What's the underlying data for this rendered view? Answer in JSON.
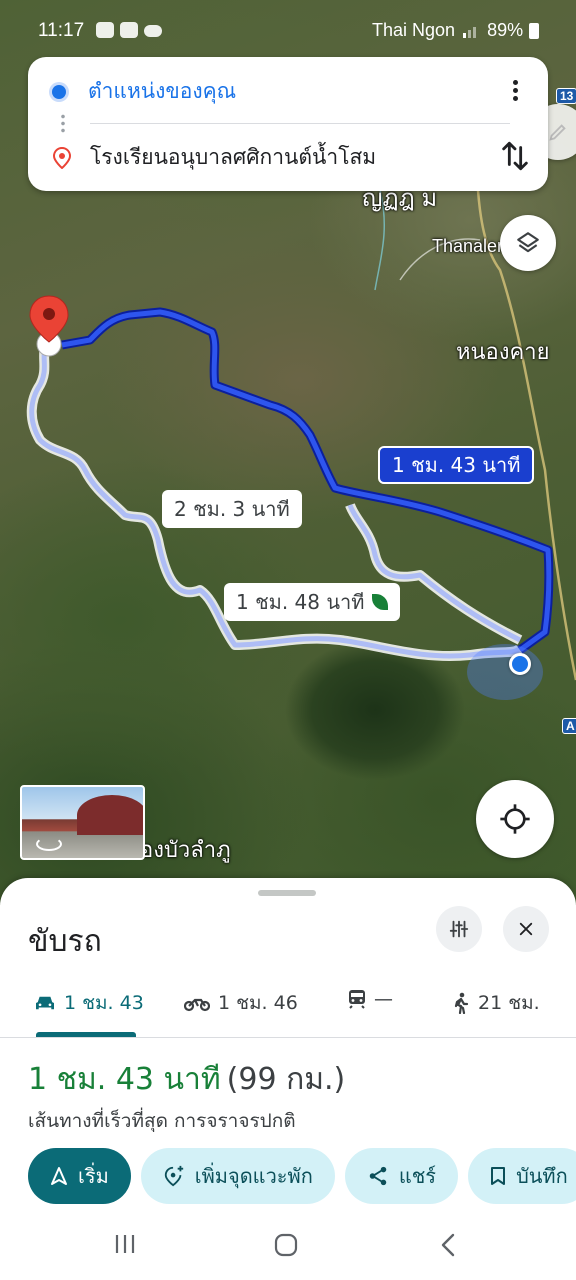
{
  "status_bar": {
    "time": "11:17",
    "carrier": "Thai Ngon",
    "battery": "89%",
    "icons": [
      "line-icon",
      "image-icon",
      "cloud-icon",
      "wifi-icon",
      "signal-icon",
      "battery-icon"
    ]
  },
  "route_inputs": {
    "origin": "ตำแหน่งของคุณ",
    "destination": "โรงเรียนอนุบาลศศิกานต์น้ำโสม"
  },
  "map": {
    "labels": {
      "thanaleng": "Thanalen",
      "nong_khai": "หนองคาย",
      "nong_bua_lam_phu": "องบัวลำภู",
      "partial_top": "ญฏฎ ม"
    },
    "shields": {
      "highway_13": "13",
      "highway_a": "A"
    },
    "callouts": {
      "main": "1 ชม. 43 นาที",
      "alt1": "2 ชม. 3 นาที",
      "alt2": "1 ชม. 48 นาที"
    },
    "colors": {
      "main_route": "#1a3fcf",
      "alt_route": "#aebdf5",
      "origin": "#1a73e8",
      "pin": "#ea4335"
    }
  },
  "sheet": {
    "title": "ขับรถ",
    "modes": [
      {
        "id": "car",
        "label": "1 ชม. 43",
        "icon": "car-icon",
        "active": true
      },
      {
        "id": "moto",
        "label": "1 ชม. 46",
        "icon": "motorcycle-icon",
        "active": false
      },
      {
        "id": "transit",
        "label": "—",
        "icon": "transit-icon",
        "active": false
      },
      {
        "id": "walk",
        "label": "21 ชม.",
        "icon": "walk-icon",
        "active": false
      }
    ],
    "duration": "1 ชม. 43 นาที",
    "distance": "(99 กม.)",
    "subline": "เส้นทางที่เร็วที่สุด การจราจรปกติ",
    "actions": {
      "start": "เริ่ม",
      "add_stop": "เพิ่มจุดแวะพัก",
      "share": "แชร์",
      "save": "บันทึก"
    },
    "colors": {
      "accent": "#0b6b77",
      "green": "#188038",
      "chip_bg": "#d3f1f7"
    }
  }
}
